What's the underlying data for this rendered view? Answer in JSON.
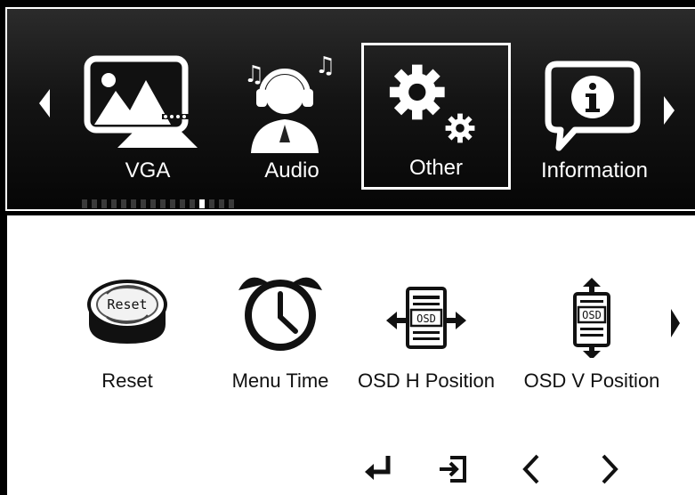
{
  "header": {
    "tabs": [
      {
        "label": "VGA",
        "icon": "picture-monitor-icon",
        "selected": false
      },
      {
        "label": "Audio",
        "icon": "headphones-person-icon",
        "selected": false
      },
      {
        "label": "Other",
        "icon": "gears-icon",
        "selected": true
      },
      {
        "label": "Information",
        "icon": "info-speech-bubble-icon",
        "selected": false
      }
    ],
    "pager": {
      "total": 16,
      "active_index": 12
    }
  },
  "submenu": {
    "items": [
      {
        "label": "Reset",
        "icon": "reset-button-icon",
        "icon_text": "Reset"
      },
      {
        "label": "Menu Time",
        "icon": "alarm-clock-icon"
      },
      {
        "label": "OSD H Position",
        "icon": "osd-horizontal-position-icon",
        "icon_text": "OSD"
      },
      {
        "label": "OSD V Position",
        "icon": "osd-vertical-position-icon",
        "icon_text": "OSD"
      }
    ]
  },
  "keys": [
    {
      "name": "enter-key",
      "icon": "enter-arrow-icon"
    },
    {
      "name": "exit-key",
      "icon": "exit-icon"
    },
    {
      "name": "left-key",
      "icon": "chevron-left-icon"
    },
    {
      "name": "right-key",
      "icon": "chevron-right-icon"
    }
  ],
  "colors": {
    "header_bg": "#141414",
    "panel_bg": "#ffffff",
    "text_light": "#ffffff",
    "text_dark": "#111111"
  }
}
